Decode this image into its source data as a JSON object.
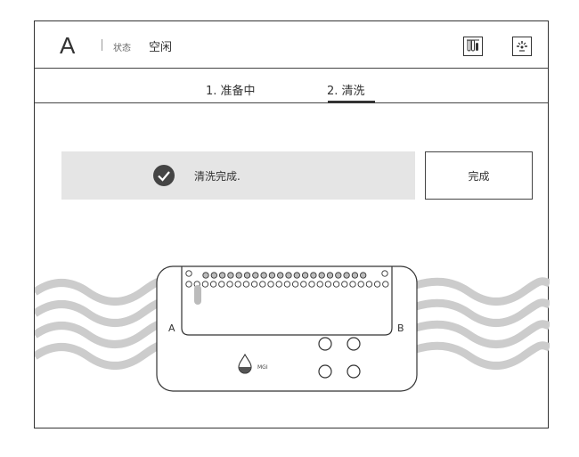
{
  "header": {
    "side": "A",
    "status_label": "状态",
    "status_value": "空闲",
    "icons": [
      "thermometer-tubes-icon",
      "light-sparkle-icon"
    ]
  },
  "tabs": [
    {
      "label": "1. 准备中",
      "active": false
    },
    {
      "label": "2. 清洗",
      "active": true
    }
  ],
  "banner": {
    "icon": "check-circle-icon",
    "message": "清洗完成."
  },
  "done_button": {
    "label": "完成"
  },
  "flowcell": {
    "label_a": "A",
    "label_b": "B",
    "brand": "MGI"
  },
  "colors": {
    "border": "#333333",
    "banner_bg": "#e5e5e5",
    "wave": "#cccccc"
  }
}
